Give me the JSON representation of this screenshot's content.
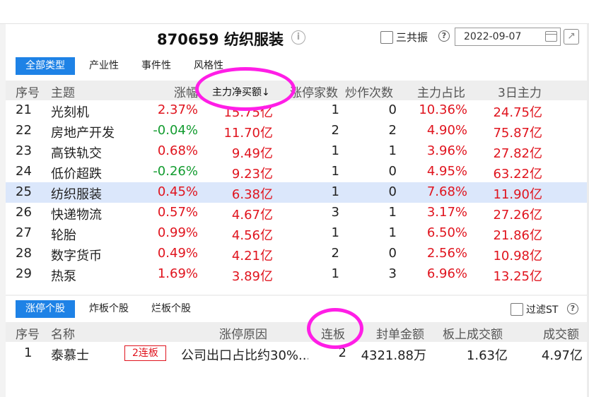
{
  "header": {
    "title": "870659 纺织服装",
    "resonance_label": "三共振",
    "date": "2022-09-07"
  },
  "type_tabs": [
    "全部类型",
    "产业性",
    "事件性",
    "风格性"
  ],
  "theme_table": {
    "columns": [
      "序号",
      "主题",
      "涨幅",
      "主力净买额↓",
      "涨停家数",
      "炒作次数",
      "主力占比",
      "3日主力"
    ],
    "rows": [
      {
        "no": "21",
        "theme": "光刻机",
        "change": "2.37%",
        "net_buy": "15.75亿",
        "limit_up": "1",
        "hype": "0",
        "ratio": "10.36%",
        "three_day": "24.75亿"
      },
      {
        "no": "22",
        "theme": "房地产开发",
        "change": "-0.04%",
        "net_buy": "11.70亿",
        "limit_up": "2",
        "hype": "2",
        "ratio": "4.90%",
        "three_day": "75.87亿"
      },
      {
        "no": "23",
        "theme": "高铁轨交",
        "change": "0.68%",
        "net_buy": "9.49亿",
        "limit_up": "1",
        "hype": "1",
        "ratio": "3.96%",
        "three_day": "27.82亿"
      },
      {
        "no": "24",
        "theme": "低价超跌",
        "change": "-0.26%",
        "net_buy": "9.23亿",
        "limit_up": "1",
        "hype": "0",
        "ratio": "4.95%",
        "three_day": "63.22亿"
      },
      {
        "no": "25",
        "theme": "纺织服装",
        "change": "0.45%",
        "net_buy": "6.38亿",
        "limit_up": "1",
        "hype": "0",
        "ratio": "7.68%",
        "three_day": "11.90亿"
      },
      {
        "no": "26",
        "theme": "快递物流",
        "change": "0.57%",
        "net_buy": "4.67亿",
        "limit_up": "3",
        "hype": "1",
        "ratio": "3.17%",
        "three_day": "27.26亿"
      },
      {
        "no": "27",
        "theme": "轮胎",
        "change": "0.99%",
        "net_buy": "4.56亿",
        "limit_up": "1",
        "hype": "1",
        "ratio": "6.50%",
        "three_day": "21.86亿"
      },
      {
        "no": "28",
        "theme": "数字货币",
        "change": "0.49%",
        "net_buy": "4.21亿",
        "limit_up": "2",
        "hype": "0",
        "ratio": "2.56%",
        "three_day": "10.98亿"
      },
      {
        "no": "29",
        "theme": "热泵",
        "change": "1.69%",
        "net_buy": "3.89亿",
        "limit_up": "1",
        "hype": "3",
        "ratio": "6.96%",
        "three_day": "13.25亿"
      }
    ]
  },
  "stock_tabs": [
    "涨停个股",
    "炸板个股",
    "烂板个股"
  ],
  "filter_st_label": "过滤ST",
  "stock_table": {
    "columns": [
      "序号",
      "名称",
      "涨停原因",
      "连板",
      "封单金额",
      "板上成交额",
      "成交额"
    ],
    "rows": [
      {
        "no": "1",
        "name": "泰慕士",
        "badge": "2连板",
        "reason": "公司出口占比约30%...",
        "boards": "2",
        "seal_amount": "4321.88万",
        "board_turnover": "1.63亿",
        "turnover": "4.97亿"
      }
    ]
  },
  "colors": {
    "accent": "#1e82e6",
    "up": "#e0141e",
    "down": "#139c30",
    "highlight": "#ff1ee6",
    "selected_row": "#dbe7fb"
  },
  "icons": [
    "info-icon",
    "help-icon",
    "calendar-icon",
    "share-icon"
  ]
}
